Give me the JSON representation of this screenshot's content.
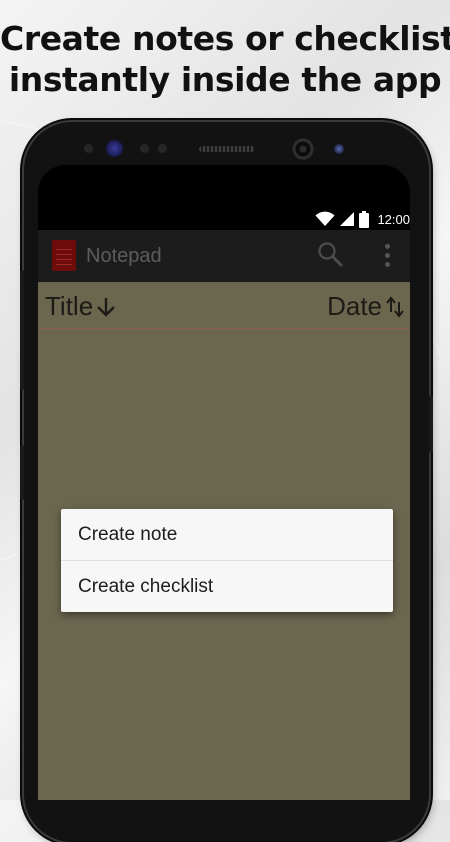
{
  "headline": {
    "line1": "Create notes or checklist",
    "line2": "instantly inside the app"
  },
  "status_bar": {
    "time": "12:00",
    "icons": [
      "wifi-icon",
      "signal-icon",
      "battery-icon"
    ]
  },
  "app_bar": {
    "title": "Notepad",
    "actions": [
      "search-icon",
      "overflow-menu-icon"
    ]
  },
  "sort_bar": {
    "title_label": "Title",
    "title_sort_icon": "arrow-down-icon",
    "date_label": "Date",
    "date_sort_icon": "sort-up-down-icon"
  },
  "create_menu": {
    "items": [
      {
        "label": "Create note"
      },
      {
        "label": "Create checklist"
      }
    ]
  },
  "colors": {
    "content_bg": "#6b674f",
    "app_bar_bg": "#1c1c1c",
    "logo": "#6e0b0b",
    "popup_bg": "#f7f7f7",
    "status_bar_bg": "#000000"
  }
}
